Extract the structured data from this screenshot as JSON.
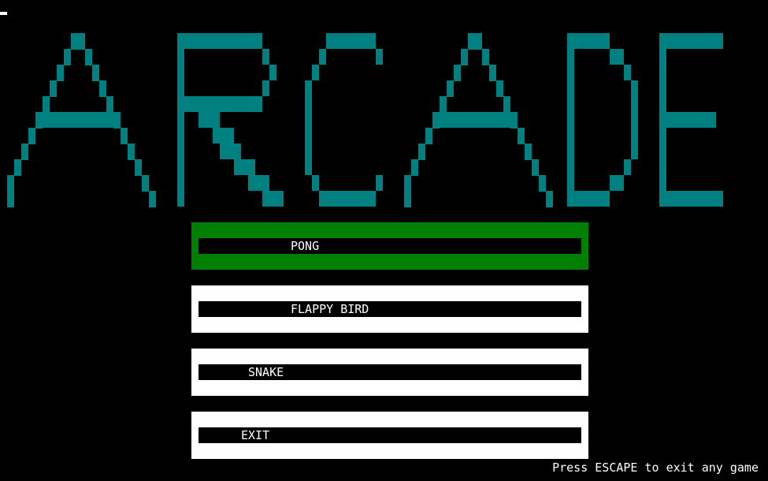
{
  "title": {
    "text": "ARCADE",
    "color": "#008080"
  },
  "menu": {
    "selected_color": "#008000",
    "normal_color": "#ffffff",
    "items": [
      {
        "label": "PONG",
        "selected": true
      },
      {
        "label": "FLAPPY BIRD",
        "selected": false
      },
      {
        "label": "SNAKE",
        "selected": false
      },
      {
        "label": "EXIT",
        "selected": false
      }
    ]
  },
  "footer": {
    "text": "Press ESCAPE to exit any game"
  }
}
